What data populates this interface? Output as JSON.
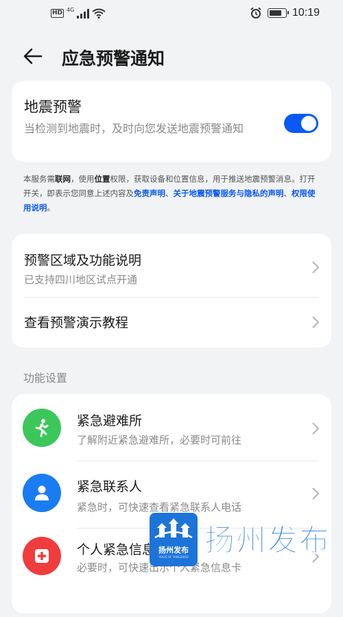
{
  "status_bar": {
    "hd": "HD",
    "network": "4G",
    "time": "10:19",
    "icons": [
      "signal-icon",
      "wifi-icon",
      "alarm-icon",
      "battery-icon"
    ]
  },
  "header": {
    "title": "应急预警通知",
    "back_icon": "arrow-left-icon"
  },
  "earthquake": {
    "title": "地震预警",
    "description": "当检测到地震时，及时向您发送地震预警通知",
    "toggle_on": true
  },
  "disclaimer": {
    "p1": "本服务需",
    "b1": "联网",
    "p2": "，使用",
    "b2": "位置",
    "p3": "权限，获取设备和位置信息，用于推送地震预警消息。打开开关，即表示您同意上述内容及",
    "link1": "免责声明",
    "sep1": "、",
    "link2": "关于地震预警服务与隐私的声明",
    "sep2": "、",
    "link3": "权限使用说明",
    "end": "。"
  },
  "info": {
    "items": [
      {
        "title": "预警区域及功能说明",
        "subtitle": "已支持四川地区试点开通"
      },
      {
        "title": "查看预警演示教程"
      }
    ]
  },
  "section_label": "功能设置",
  "functions": {
    "items": [
      {
        "title": "紧急避难所",
        "subtitle": "了解附近紧急避难所，必要时可前往",
        "icon": "running-person-icon",
        "color": "#3cc75a"
      },
      {
        "title": "紧急联系人",
        "subtitle": "紧急时，可快速查看紧急联系人电话",
        "icon": "contact-person-icon",
        "color": "#1a7cf2"
      },
      {
        "title": "个人紧急信息",
        "subtitle": "必要时，可快速出示个人紧急信息卡",
        "icon": "medical-cross-icon",
        "color": "#f03c3c"
      }
    ]
  },
  "watermark": {
    "logo_text": "扬州发布",
    "logo_small": "VOICE OF YANGZHOU",
    "text": "扬州发布",
    "color": "#1d74d8"
  },
  "colors": {
    "accent": "#0a59f7",
    "background": "#f1f3f5"
  }
}
